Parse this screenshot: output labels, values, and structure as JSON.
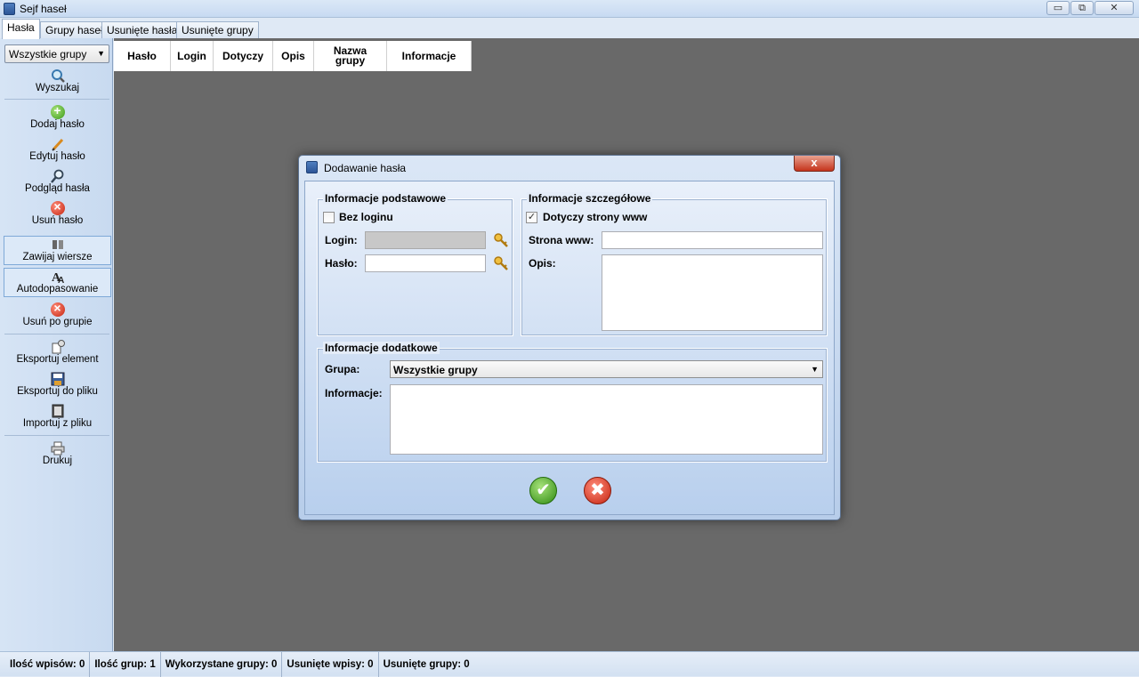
{
  "window": {
    "title": "Sejf haseł",
    "minimize": "▭",
    "maximize": "⧉",
    "close": "✕"
  },
  "tabs": [
    "Hasła",
    "Grupy haseł",
    "Usunięte hasła",
    "Usunięte grupy"
  ],
  "sidebar": {
    "group_select": "Wszystkie grupy",
    "items": {
      "search": "Wyszukaj",
      "add_password": "Dodaj hasło",
      "edit_password": "Edytuj hasło",
      "preview_password": "Podgląd hasła",
      "delete_password": "Usuń hasło",
      "wrap_rows": "Zawijaj wiersze",
      "autofit": "Autodopasowanie",
      "delete_by_group": "Usuń po grupie",
      "export_element": "Eksportuj element",
      "export_file": "Eksportuj do pliku",
      "import_file": "Importuj z pliku",
      "print": "Drukuj"
    },
    "icons": [
      "search-icon",
      "add-icon",
      "pencil-icon",
      "magnifier-icon",
      "delete-icon",
      "wrap-icon",
      "autofit-icon",
      "delete-group-icon",
      "export-element-icon",
      "floppy-icon",
      "import-icon",
      "printer-icon"
    ]
  },
  "grid": {
    "columns": [
      "Hasło",
      "Login",
      "Dotyczy",
      "Opis",
      "Nazwa grupy",
      "Informacje"
    ]
  },
  "dialog": {
    "title": "Dodawanie hasła",
    "close": "x",
    "basic": {
      "legend": "Informacje podstawowe",
      "no_login_label": "Bez loginu",
      "no_login_checked": false,
      "login_label": "Login:",
      "login_value": "",
      "password_label": "Hasło:",
      "password_value": ""
    },
    "details": {
      "legend": "Informacje szczegółowe",
      "website_check_label": "Dotyczy strony www",
      "website_checked": true,
      "website_label": "Strona www:",
      "website_value": "",
      "description_label": "Opis:",
      "description_value": ""
    },
    "extra": {
      "legend": "Informacje dodatkowe",
      "group_label": "Grupa:",
      "group_value": "Wszystkie grupy",
      "info_label": "Informacje:",
      "info_value": ""
    },
    "ok_icon": "✔",
    "cancel_icon": "✖"
  },
  "statusbar": {
    "entries": "Ilość wpisów: 0",
    "groups": "Ilość grup: 1",
    "used_groups": "Wykorzystane grupy: 0",
    "deleted_entries": "Usunięte wpisy: 0",
    "deleted_groups": "Usunięte grupy: 0"
  },
  "colors": {
    "accent": "#3c9a18",
    "danger": "#c4230f",
    "workspace": "#696969"
  }
}
